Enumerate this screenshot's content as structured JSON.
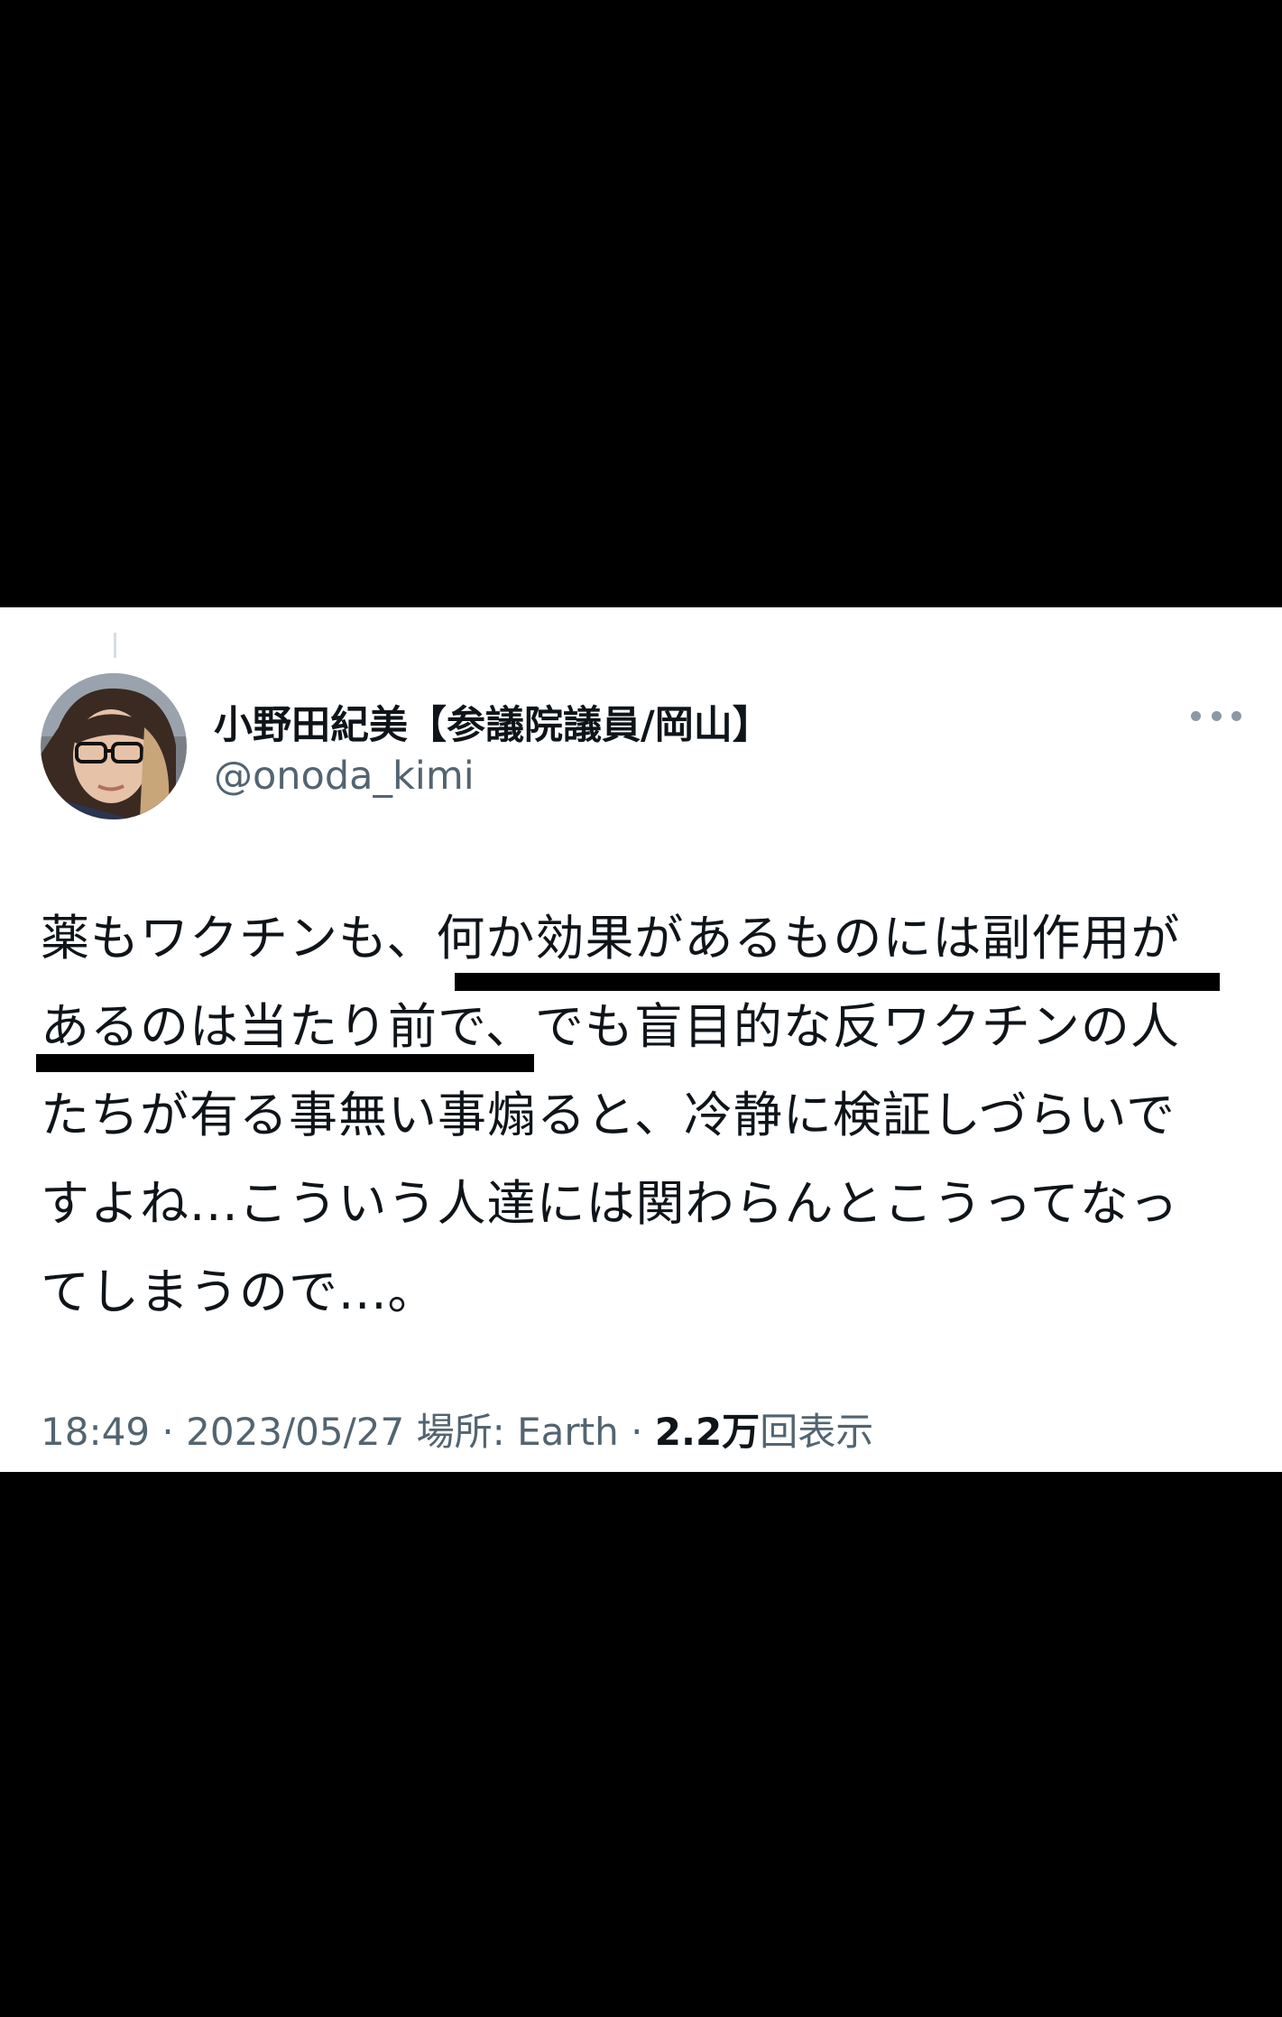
{
  "tweet": {
    "display_name": "小野田紀美【参議院議員/岡山】",
    "handle": "@onoda_kimi",
    "body_lines": [
      "薬もワクチンも、何か効果があるものには副作用が",
      "あるのは当たり前で、でも盲目的な反ワクチンの人",
      "たちが有る事無い事煽ると、冷静に検証しづらいで",
      "すよね...こういう人達には関わらんとこうってなっ",
      "てしまうので...。"
    ],
    "time": "18:49",
    "separator": "·",
    "date": "2023/05/27",
    "location_label": "場所: Earth",
    "views_count": "2.2万",
    "views_label": "回表示"
  },
  "icons": {
    "more": "more-horizontal-icon",
    "avatar": "profile-avatar"
  },
  "colors": {
    "background": "#000000",
    "card": "#ffffff",
    "text_primary": "#0f1419",
    "text_secondary": "#536471",
    "underline": "#000000"
  }
}
